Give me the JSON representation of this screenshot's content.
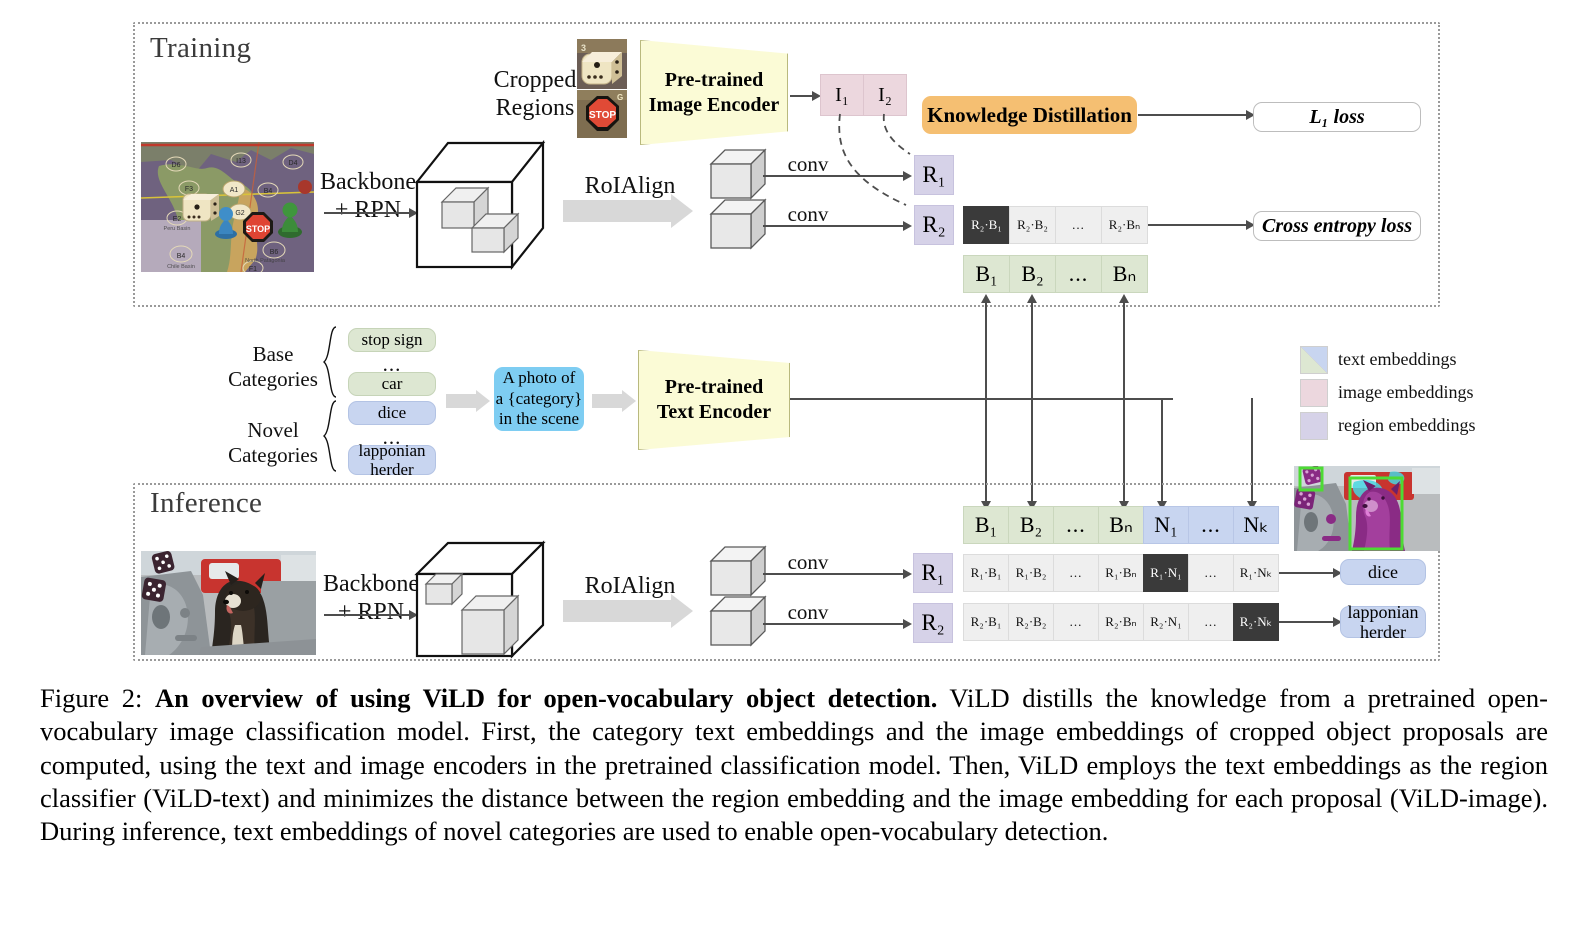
{
  "figure": {
    "label": "Figure 2:",
    "title_bold": "An overview of using ViLD for open-vocabulary object detection.",
    "caption_rest": " ViLD distills the knowledge from a pretrained open-vocabulary image classification model. First, the category text embeddings and the image embeddings of cropped object proposals are computed, using the text and image encoders in the pretrained classification model. Then, ViLD employs the text embeddings as the region classifier (ViLD-text) and minimizes the distance between the region embedding and the image embedding for each proposal (ViLD-image). During inference, text embeddings of novel categories are used to enable open-vocabulary detection."
  },
  "training": {
    "section_title": "Training",
    "cropped_regions_label": "Cropped\nRegions",
    "backbone_label": "Backbone\n+ RPN",
    "roialign_label": "RoIAlign",
    "conv_label_1": "conv",
    "conv_label_2": "conv",
    "image_encoder_label": "Pre-trained\nImage Encoder",
    "knowledge_distillation_label": "Knowledge Distillation",
    "l1_loss_label": "L₁ loss",
    "cross_entropy_loss_label": "Cross entropy loss",
    "image_embeddings": [
      "I₁",
      "I₂"
    ],
    "region_embeddings": [
      "R₁",
      "R₂"
    ],
    "score_row": [
      "R₂·B₁",
      "R₂·B₂",
      "...",
      "R₂·Bₙ"
    ],
    "score_row_highlight_index": 0,
    "base_embedding_row": [
      "B₁",
      "B₂",
      "...",
      "Bₙ"
    ]
  },
  "categories": {
    "base_label": "Base\nCategories",
    "novel_label": "Novel\nCategories",
    "base_items": [
      "stop sign",
      "...",
      "car"
    ],
    "novel_items": [
      "dice",
      "...",
      "lapponian\nherder"
    ],
    "prompt_text": "A photo of\na {category}\nin the scene",
    "text_encoder_label": "Pre-trained\nText Encoder"
  },
  "legend": {
    "items": [
      {
        "name": "text embeddings",
        "swatch": "split-blue-green"
      },
      {
        "name": "image embeddings",
        "swatch": "#ecd7de"
      },
      {
        "name": "region embeddings",
        "swatch": "#d6d2e8"
      }
    ]
  },
  "inference": {
    "section_title": "Inference",
    "backbone_label": "Backbone\n+ RPN",
    "roialign_label": "RoIAlign",
    "conv_label_1": "conv",
    "conv_label_2": "conv",
    "region_embeddings": [
      "R₁",
      "R₂"
    ],
    "embedding_row": [
      "B₁",
      "B₂",
      "...",
      "Bₙ",
      "N₁",
      "...",
      "Nₖ"
    ],
    "embedding_row_kinds": [
      "base",
      "base",
      "base",
      "base",
      "novel",
      "novel",
      "novel"
    ],
    "score_row_1": [
      "R₁·B₁",
      "R₁·B₂",
      "...",
      "R₁·Bₙ",
      "R₁·N₁",
      "...",
      "R₁·Nₖ"
    ],
    "score_row_1_highlight_index": 4,
    "score_row_2": [
      "R₂·B₁",
      "R₂·B₂",
      "...",
      "R₂·Bₙ",
      "R₂·N₁",
      "...",
      "R₂·Nₖ"
    ],
    "score_row_2_highlight_index": 6,
    "output_labels": [
      "dice",
      "lapponian\nherder"
    ]
  },
  "colors": {
    "text_embedding_base": "#dde7d2",
    "text_embedding_novel": "#c8d5f0",
    "image_embedding": "#ecd7de",
    "region_embedding": "#d6d2e8",
    "encoder_fill": "#fbfbd6",
    "knowledge_distillation": "#f5bf72",
    "prompt_fill": "#7ecdf2",
    "highlight_cell": "#3a3a3a",
    "score_cell": "#efefef",
    "arrow": "#4d4d4d",
    "block_arrow": "#d8d8d8",
    "detection_box": "#4ddb34",
    "mask": "#8b1f7e"
  }
}
